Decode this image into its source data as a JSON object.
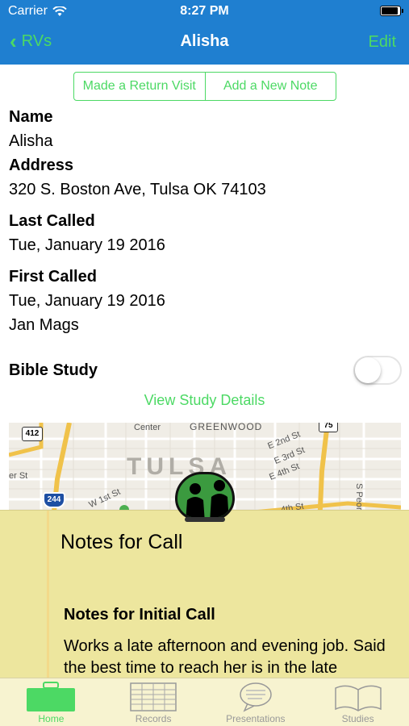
{
  "status_bar": {
    "carrier": "Carrier",
    "time": "8:27 PM"
  },
  "nav": {
    "back_label": "RVs",
    "title": "Alisha",
    "edit_label": "Edit"
  },
  "actions": {
    "return_visit": "Made a Return Visit",
    "add_note": "Add a New Note"
  },
  "details": {
    "name_label": "Name",
    "name_value": "Alisha",
    "address_label": "Address",
    "address_value": "320 S. Boston Ave, Tulsa OK 74103",
    "last_called_label": "Last Called",
    "last_called_value": "Tue, January 19 2016",
    "first_called_label": "First Called",
    "first_called_value": "Tue, January 19 2016",
    "first_called_publication": "Jan Mags"
  },
  "bible_study": {
    "label": "Bible Study",
    "enabled": false,
    "link": "View Study Details"
  },
  "map": {
    "city": "TULSA",
    "labels": [
      "Center",
      "GREENWOOD",
      "E 2nd St",
      "E 3rd St",
      "E 4th St",
      "4th St",
      "S Peoria Av",
      "W 1st St",
      "er St"
    ],
    "shields": [
      "412",
      "244",
      "75"
    ]
  },
  "notes": {
    "title": "Notes for Call",
    "heading": "Notes for Initial Call",
    "body": "Works a late afternoon and evening job. Said the best time to reach her is in the late"
  },
  "tabs": [
    {
      "label": "Home",
      "icon": "briefcase-icon",
      "active": true
    },
    {
      "label": "Records",
      "icon": "ledger-icon",
      "active": false
    },
    {
      "label": "Presentations",
      "icon": "speech-bubble-icon",
      "active": false
    },
    {
      "label": "Studies",
      "icon": "book-icon",
      "active": false
    }
  ],
  "colors": {
    "nav_bg": "#1f7fd0",
    "accent": "#4cd964",
    "note_bg": "#ede69e",
    "tab_bg": "#f7f3d0"
  }
}
